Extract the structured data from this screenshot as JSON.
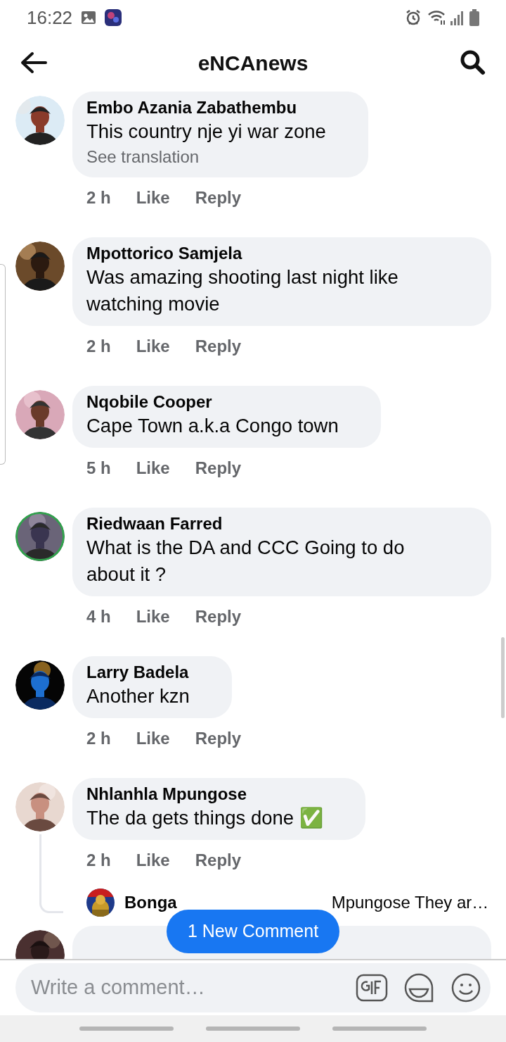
{
  "status_bar": {
    "time": "16:22"
  },
  "header": {
    "title": "eNCAnews"
  },
  "comments": [
    {
      "author": "Embo Azania Zabathembu",
      "text": "This country nje yi war zone",
      "translation": "See translation",
      "time": "2 h",
      "like": "Like",
      "reply": "Reply",
      "story_ring": false
    },
    {
      "author": "Mpottorico Samjela",
      "text": "Was amazing shooting last night like watching movie",
      "time": "2 h",
      "like": "Like",
      "reply": "Reply",
      "story_ring": false
    },
    {
      "author": "Nqobile Cooper",
      "text": "Cape Town a.k.a Congo town",
      "time": "5 h",
      "like": "Like",
      "reply": "Reply",
      "story_ring": false
    },
    {
      "author": "Riedwaan Farred",
      "text": "What is the DA and CCC Going to do about it  ?",
      "time": "4 h",
      "like": "Like",
      "reply": "Reply",
      "story_ring": true
    },
    {
      "author": "Larry Badela",
      "text": "Another kzn",
      "time": "2 h",
      "like": "Like",
      "reply": "Reply",
      "story_ring": false
    },
    {
      "author": "Nhlanhla Mpungose",
      "text": "The da gets things done ✅",
      "time": "2 h",
      "like": "Like",
      "reply": "Reply",
      "story_ring": false,
      "reply_preview": {
        "author": "Bonga",
        "text": "Mpungose They ar…"
      }
    }
  ],
  "new_comment_button": "1 New Comment",
  "composer": {
    "placeholder": "Write a comment…"
  }
}
